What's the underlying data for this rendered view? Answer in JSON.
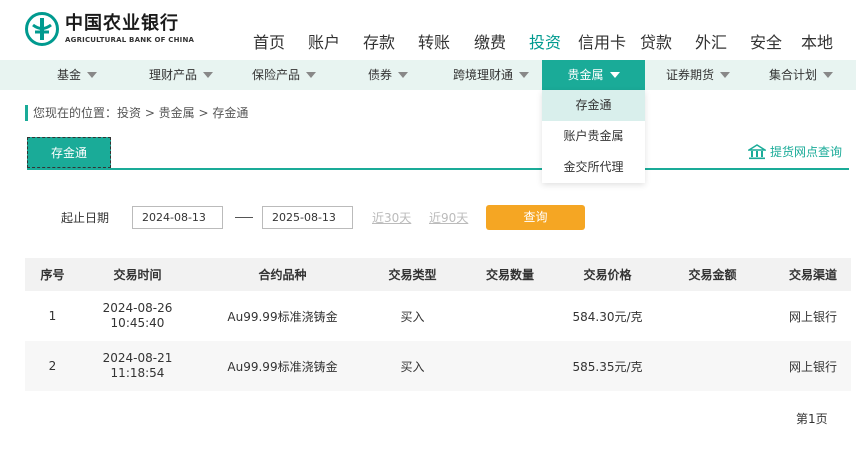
{
  "brand": {
    "name_cn": "中国农业银行",
    "name_en": "AGRICULTURAL BANK OF CHINA",
    "color": "#009a8f"
  },
  "top_nav": [
    "首页",
    "账户",
    "存款",
    "转账",
    "缴费",
    "投资",
    "信用卡",
    "贷款",
    "外汇",
    "安全",
    "本地"
  ],
  "top_nav_active": "投资",
  "sub_nav": [
    "基金",
    "理财产品",
    "保险产品",
    "债券",
    "跨境理财通",
    "贵金属",
    "证券期货",
    "集合计划"
  ],
  "sub_nav_active": "贵金属",
  "dropdown": [
    "存金通",
    "账户贵金属",
    "金交所代理"
  ],
  "breadcrumb": "您现在的位置：投资 > 贵金属 > 存金通",
  "tab": "存金通",
  "tihuo_link": "提货网点查询",
  "filter": {
    "label": "起止日期",
    "start_date": "2024-08-13",
    "end_date": "2025-08-13",
    "quick_30": "近30天",
    "quick_90": "近90天",
    "query": "查询"
  },
  "table": {
    "headers": [
      "序号",
      "交易时间",
      "合约品种",
      "交易类型",
      "交易数量",
      "交易价格",
      "交易金额",
      "交易渠道"
    ],
    "rows": [
      {
        "no": "1",
        "date": "2024-08-26",
        "time": "10:45:40",
        "product": "Au99.99标准浇铸金",
        "type": "买入",
        "qty": "",
        "price": "584.30元/克",
        "amount": "",
        "channel": "网上银行"
      },
      {
        "no": "2",
        "date": "2024-08-21",
        "time": "11:18:54",
        "product": "Au99.99标准浇铸金",
        "type": "买入",
        "qty": "",
        "price": "585.35元/克",
        "amount": "",
        "channel": "网上银行"
      }
    ]
  },
  "pager": "第1页",
  "colors": {
    "accent": "#1aab98",
    "button": "#f5a623",
    "subnav_bg": "#e8f4f1"
  }
}
